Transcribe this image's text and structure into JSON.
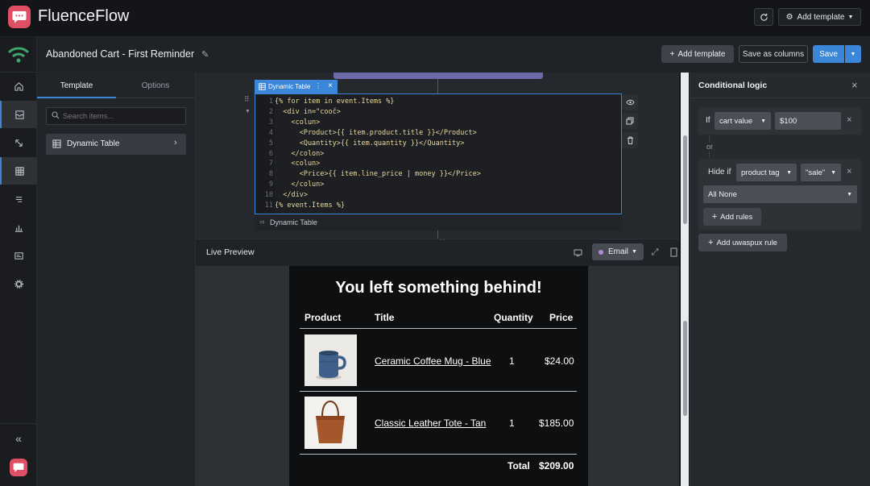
{
  "app": {
    "name": "FluenceFlow",
    "brand_color": "#e04f63"
  },
  "topbar": {
    "refresh_icon": "refresh-icon",
    "add_template_label": "Add template"
  },
  "header": {
    "title": "Abandoned Cart - First Reminder",
    "add_template_label": "Add template",
    "save_as_columns_label": "Save as columns",
    "save_label": "Save",
    "accent": "#3b86d8"
  },
  "rail": {
    "icons": [
      "home-icon",
      "inbox-icon",
      "arrow-icon",
      "table-icon",
      "list-icon",
      "chart-icon",
      "layout-icon",
      "settings-icon"
    ],
    "collapse_icon": "double-chevron-left-icon"
  },
  "left_panel": {
    "tabs": [
      "Template",
      "Options"
    ],
    "search_placeholder": "Search items...",
    "items": [
      {
        "label": "Dynamic Table"
      }
    ]
  },
  "editor": {
    "tab_label": "Dynamic Table",
    "hidden_header": "",
    "lines": [
      "{% for item in event.Items %}",
      "  <div in=\"cooč>",
      "    <colun>",
      "      <Product>{{ item.product.title }}</Product>",
      "      <Quantity>{{ item.quantity }}</Quantity>",
      "    </colon>",
      "    <colun>",
      "      <Price>{{ item.line_price | money }}</Price>",
      "    </colun>",
      "  </div>",
      "{% event.Items %}"
    ],
    "footer_label": "Dynamic Table"
  },
  "preview": {
    "title": "Live Preview",
    "mode_label": "Email",
    "email": {
      "heading": "You left something behind!",
      "columns": [
        "Product",
        "Title",
        "Quantity",
        "Price"
      ],
      "rows": [
        {
          "title": "Ceramic Coffee Mug - Blue",
          "quantity": "1",
          "price": "$24.00"
        },
        {
          "title": "Classic Leather Tote - Tan",
          "quantity": "1",
          "price": "$185.00"
        }
      ],
      "total_label": "Total",
      "total_value": "$209.00"
    }
  },
  "conditional_logic": {
    "title": "Conditional logic",
    "rule1": {
      "if_label": "If",
      "field": "cart value",
      "value": "$100"
    },
    "or_label": "or",
    "rule2": {
      "hide_label": "Hide if",
      "field": "product tag",
      "value": "\"sale\"",
      "all_none": "All None",
      "add_rules_label": "Add rules"
    },
    "add_rule_label": "Add uwaspux rule"
  }
}
